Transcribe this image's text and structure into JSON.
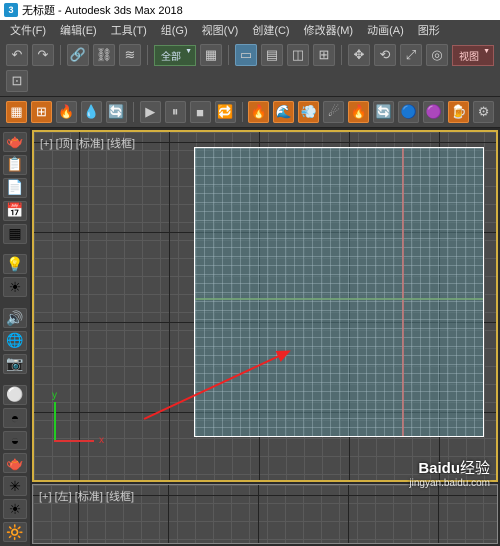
{
  "title": "无标题 - Autodesk 3ds Max 2018",
  "menu": [
    "文件(F)",
    "编辑(E)",
    "工具(T)",
    "组(G)",
    "视图(V)",
    "创建(C)",
    "修改器(M)",
    "动画(A)",
    "图形"
  ],
  "scope_label": "全部",
  "view_label": "视图",
  "viewports": {
    "top": "[+] [顶] [标准] [线框]",
    "left": "[+] [左] [标准] [线框]"
  },
  "gizmo": {
    "x": "x",
    "y": "y"
  },
  "watermark": {
    "main": "Baidu",
    "ext": "经验",
    "sub": "jingyan.baidu.com"
  },
  "colors": {
    "orange": "#cc6a1a",
    "grid_bg": "#4a4a4a",
    "plane": "rgba(90,140,150,0.5)",
    "active_border": "#d4b040"
  }
}
